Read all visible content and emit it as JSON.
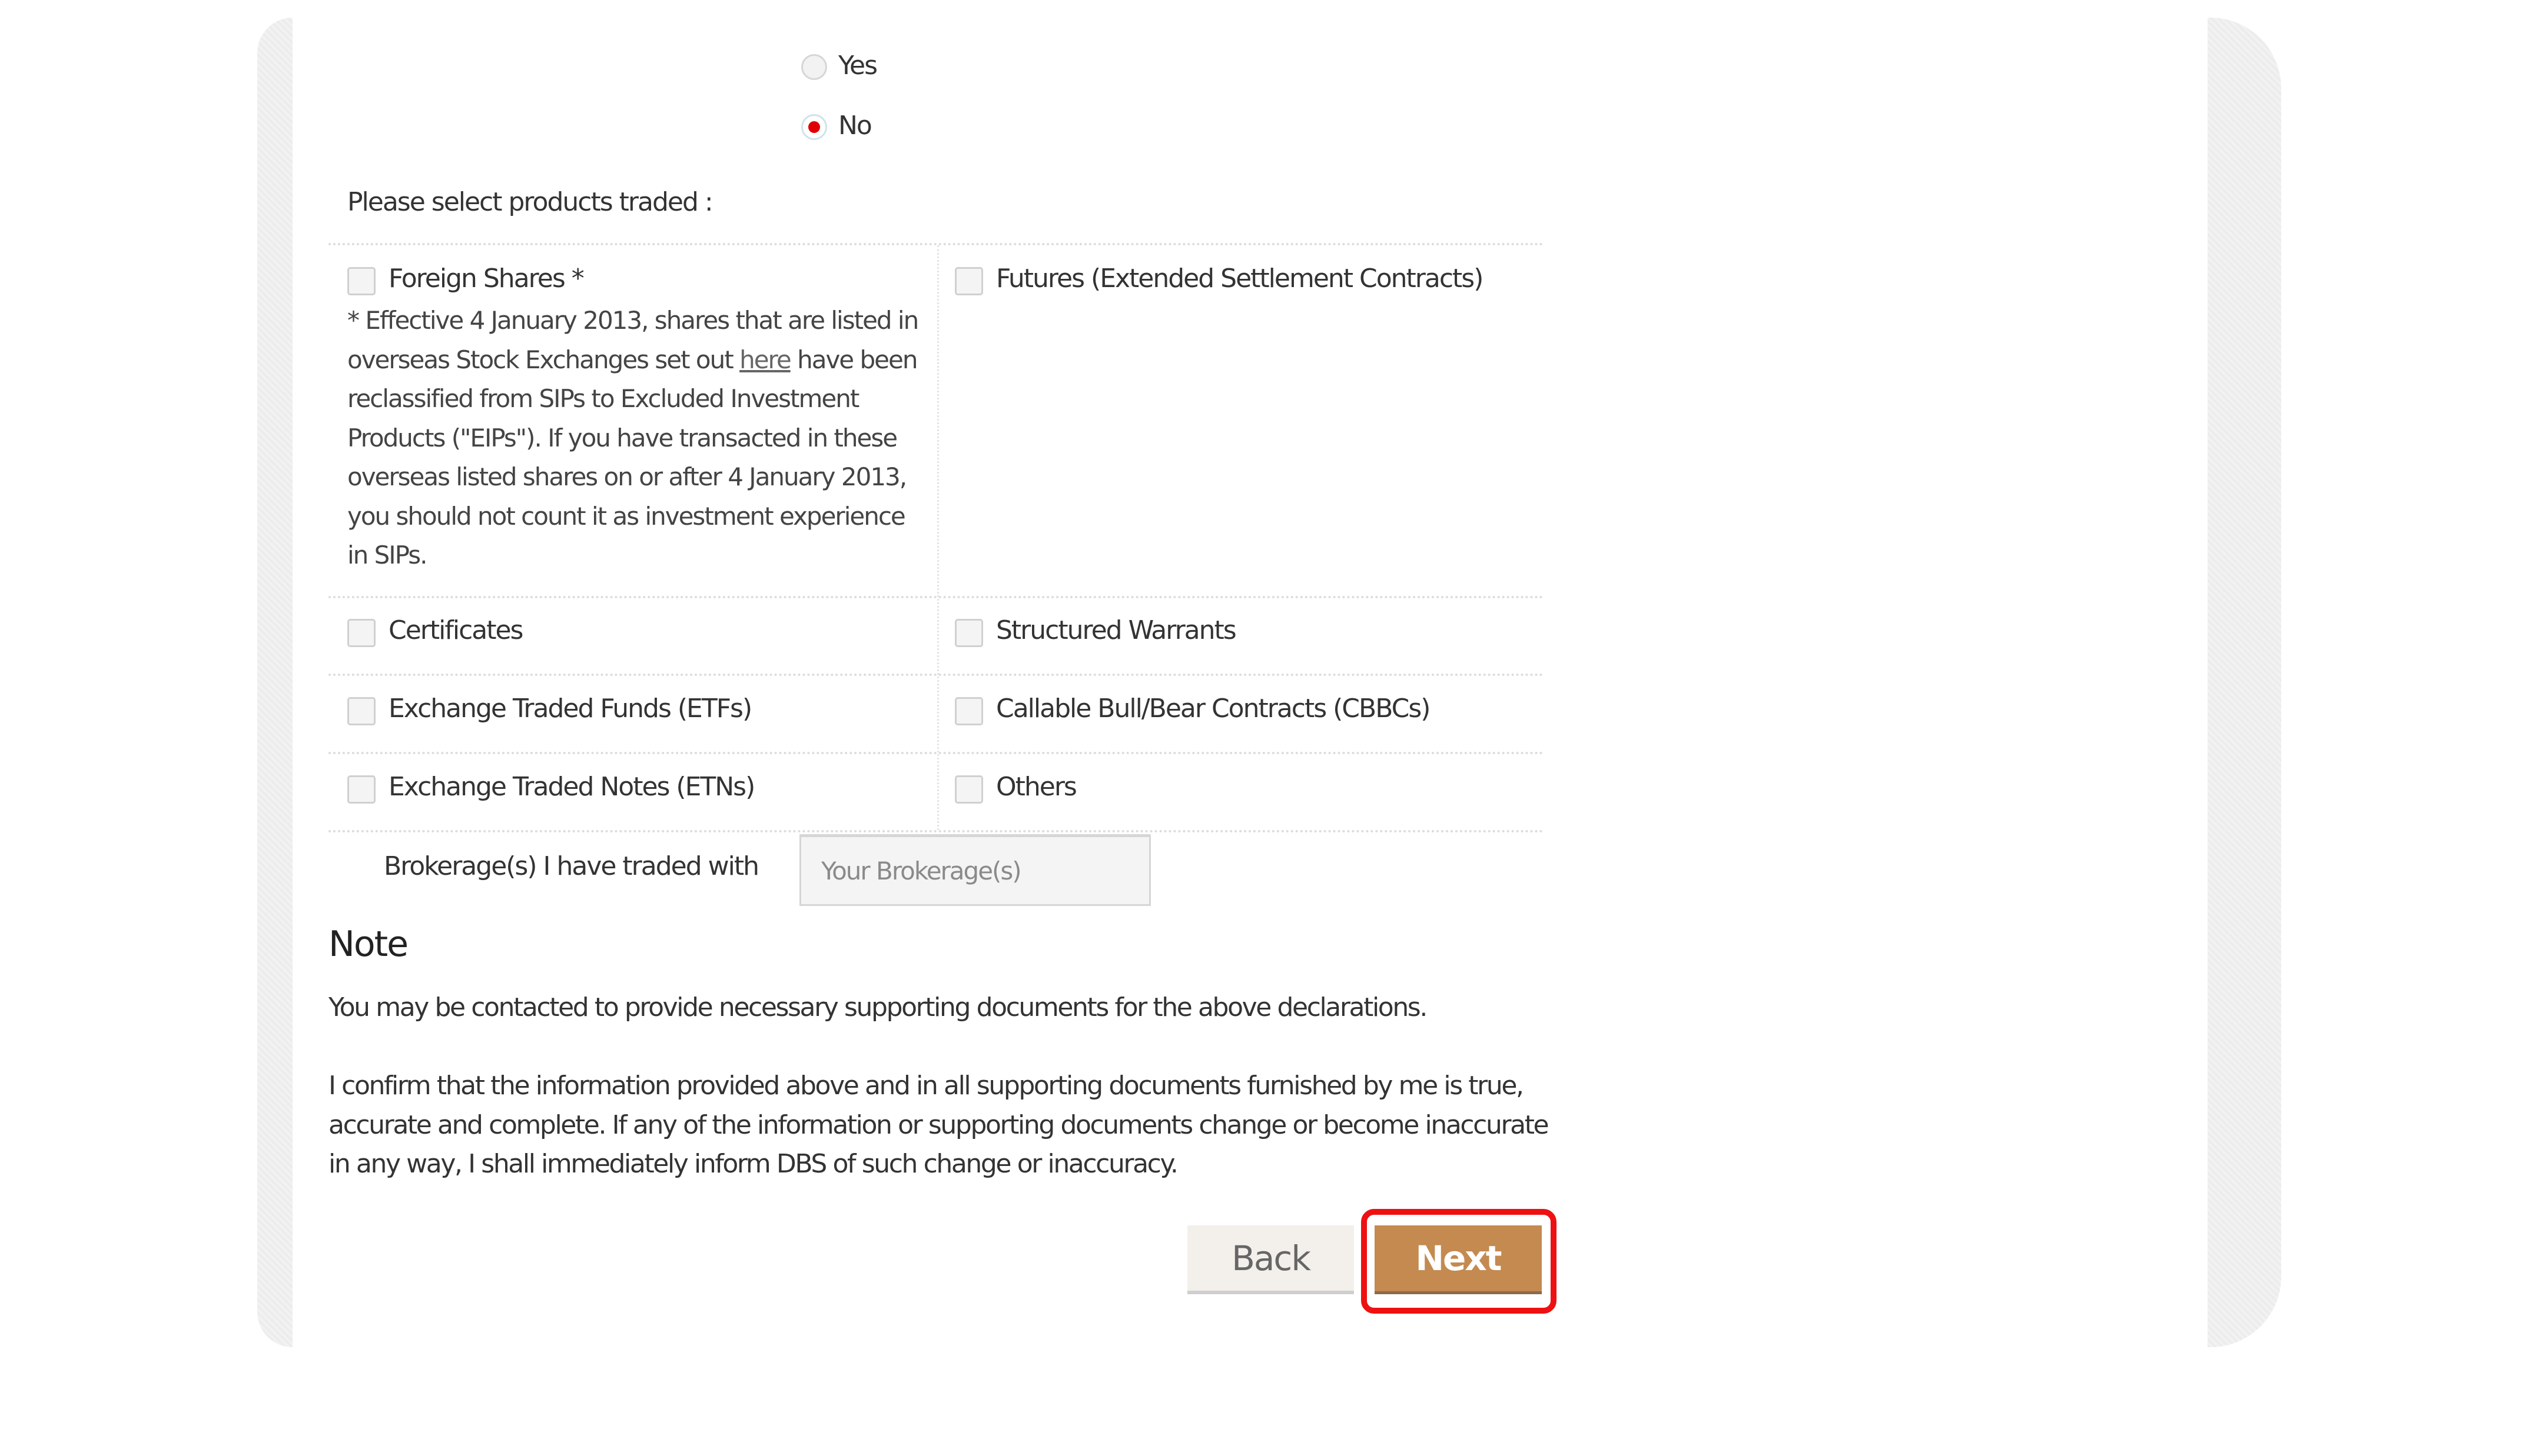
{
  "question": {
    "options": [
      {
        "label": "Yes",
        "selected": false
      },
      {
        "label": "No",
        "selected": true
      }
    ]
  },
  "products": {
    "prompt": "Please select products traded :",
    "items": [
      {
        "label": "Foreign Shares *",
        "checked": false
      },
      {
        "label": "Futures (Extended Settlement Contracts)",
        "checked": false
      },
      {
        "label": "Certificates",
        "checked": false
      },
      {
        "label": "Structured Warrants",
        "checked": false
      },
      {
        "label": "Exchange Traded Funds (ETFs)",
        "checked": false
      },
      {
        "label": "Callable Bull/Bear Contracts (CBBCs)",
        "checked": false
      },
      {
        "label": "Exchange Traded Notes (ETNs)",
        "checked": false
      },
      {
        "label": "Others",
        "checked": false
      }
    ],
    "footnote": {
      "before_link": "* Effective 4 January 2013, shares that are listed in overseas Stock Exchanges set out ",
      "link_text": "here",
      "after_link": " have been reclassified from SIPs to Excluded Investment Products (\"EIPs\"). If you have transacted in these overseas listed shares on or after 4 January 2013, you should not count it as investment experience in SIPs."
    }
  },
  "brokerage": {
    "label": "Brokerage(s) I have traded with",
    "value": "",
    "placeholder": "Your Brokerage(s)"
  },
  "note": {
    "heading": "Note",
    "paragraph1": "You may be contacted to provide necessary supporting documents for the above declarations.",
    "paragraph2": "I confirm that the information provided above and in all supporting documents furnished by me is true, accurate and complete. If any of the information or supporting documents change or become inaccurate in any way, I shall immediately inform DBS of such change or inaccuracy."
  },
  "buttons": {
    "back": "Back",
    "next": "Next"
  },
  "colors": {
    "next_button": "#c48a50",
    "back_button": "#f3f0ec",
    "radio_selected": "#e00000",
    "highlight_outline": "#ee1111"
  }
}
